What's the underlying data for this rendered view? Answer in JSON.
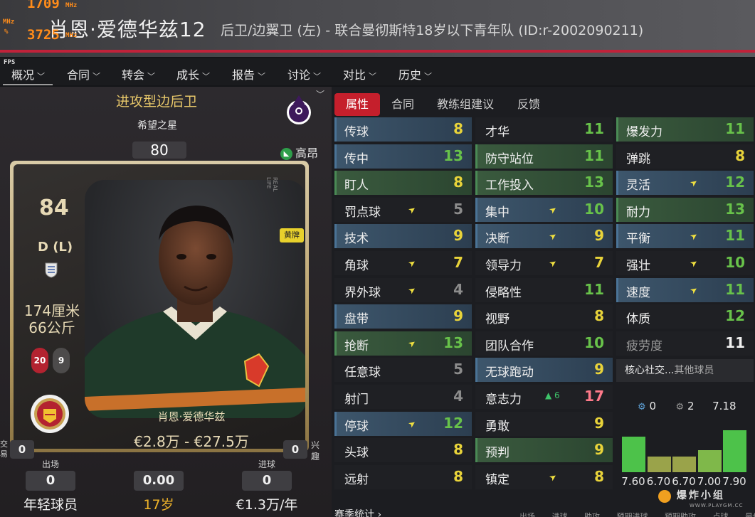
{
  "overlay": {
    "line1": "1709",
    "line2": "3725",
    "unit": "MHz",
    "fps": "FPS"
  },
  "header": {
    "title": "肖恩·爱德华兹12",
    "info": "后卫/边翼卫 (左) - 联合曼彻斯特18岁以下青年队 (ID:r-2002090211)"
  },
  "nav": [
    {
      "label": "概况"
    },
    {
      "label": "合同"
    },
    {
      "label": "转会"
    },
    {
      "label": "成长"
    },
    {
      "label": "报告"
    },
    {
      "label": "讨论"
    },
    {
      "label": "对比"
    },
    {
      "label": "历史"
    }
  ],
  "profile": {
    "role": "进攻型边后卫",
    "subtitle": "希望之星",
    "ovr": "80",
    "stars": {
      "full": 1,
      "half": 1,
      "empty": 3
    },
    "height_tag": "高昂",
    "card": {
      "rating": "84",
      "position": "D (L)",
      "height": "174厘米",
      "weight": "66公斤",
      "pill_red": "20",
      "pill_grey": "9",
      "real_life": "REAL LIFE",
      "yellow_tag": "黄牌",
      "name": "肖恩·爱德华兹",
      "value": "€2.8万 - €27.5万"
    },
    "left_side_label": "交易",
    "left_side_value": "0",
    "right_side_label": "兴趣",
    "right_side_value": "0",
    "stats": [
      {
        "label": "出场",
        "value": "0",
        "text": "年轻球员",
        "gold": false
      },
      {
        "label": "",
        "value": "0.00",
        "text": "17岁",
        "gold": true
      },
      {
        "label": "进球",
        "value": "0",
        "text": "€1.3万/年",
        "gold": false
      }
    ]
  },
  "tabs": [
    {
      "label": "属性",
      "active": true
    },
    {
      "label": "合同",
      "active": false
    },
    {
      "label": "教练组建议",
      "active": false
    },
    {
      "label": "反馈",
      "active": false
    }
  ],
  "attributes": {
    "col1": [
      {
        "name": "传球",
        "value": "8",
        "bg": "blue",
        "color": "yellow",
        "arrow": false
      },
      {
        "name": "传中",
        "value": "13",
        "bg": "blue",
        "color": "green",
        "arrow": false
      },
      {
        "name": "盯人",
        "value": "8",
        "bg": "green",
        "color": "yellow",
        "arrow": false
      },
      {
        "name": "罚点球",
        "value": "5",
        "bg": "none",
        "color": "grey",
        "arrow": true
      },
      {
        "name": "技术",
        "value": "9",
        "bg": "blue",
        "color": "yellow",
        "arrow": false
      },
      {
        "name": "角球",
        "value": "7",
        "bg": "none",
        "color": "yellow",
        "arrow": true
      },
      {
        "name": "界外球",
        "value": "4",
        "bg": "none",
        "color": "grey",
        "arrow": true
      },
      {
        "name": "盘带",
        "value": "9",
        "bg": "blue",
        "color": "yellow",
        "arrow": false
      },
      {
        "name": "抢断",
        "value": "13",
        "bg": "green",
        "color": "green",
        "arrow": true
      },
      {
        "name": "任意球",
        "value": "5",
        "bg": "none",
        "color": "grey",
        "arrow": false
      },
      {
        "name": "射门",
        "value": "4",
        "bg": "none",
        "color": "grey",
        "arrow": false
      },
      {
        "name": "停球",
        "value": "12",
        "bg": "blue",
        "color": "green",
        "arrow": true
      },
      {
        "name": "头球",
        "value": "8",
        "bg": "none",
        "color": "yellow",
        "arrow": false
      },
      {
        "name": "远射",
        "value": "8",
        "bg": "none",
        "color": "yellow",
        "arrow": false
      }
    ],
    "col2": [
      {
        "name": "才华",
        "value": "11",
        "bg": "none",
        "color": "green",
        "arrow": false
      },
      {
        "name": "防守站位",
        "value": "11",
        "bg": "green",
        "color": "green",
        "arrow": false
      },
      {
        "name": "工作投入",
        "value": "13",
        "bg": "green",
        "color": "green",
        "arrow": false
      },
      {
        "name": "集中",
        "value": "10",
        "bg": "blue",
        "color": "green",
        "arrow": true
      },
      {
        "name": "决断",
        "value": "9",
        "bg": "blue",
        "color": "yellow",
        "arrow": true
      },
      {
        "name": "领导力",
        "value": "7",
        "bg": "none",
        "color": "yellow",
        "arrow": true
      },
      {
        "name": "侵略性",
        "value": "11",
        "bg": "none",
        "color": "green",
        "arrow": false
      },
      {
        "name": "视野",
        "value": "8",
        "bg": "none",
        "color": "yellow",
        "arrow": false
      },
      {
        "name": "团队合作",
        "value": "10",
        "bg": "none",
        "color": "green",
        "arrow": false
      },
      {
        "name": "无球跑动",
        "value": "9",
        "bg": "blue",
        "color": "yellow",
        "arrow": false
      },
      {
        "name": "意志力",
        "value": "17",
        "bg": "none",
        "color": "pink",
        "arrow": false,
        "delta": "▲ 6"
      },
      {
        "name": "勇敢",
        "value": "9",
        "bg": "none",
        "color": "yellow",
        "arrow": false
      },
      {
        "name": "预判",
        "value": "9",
        "bg": "green",
        "color": "yellow",
        "arrow": false
      },
      {
        "name": "镇定",
        "value": "8",
        "bg": "none",
        "color": "yellow",
        "arrow": true
      }
    ],
    "col3": [
      {
        "name": "爆发力",
        "value": "11",
        "bg": "green",
        "color": "green",
        "arrow": false
      },
      {
        "name": "弹跳",
        "value": "8",
        "bg": "none",
        "color": "yellow",
        "arrow": false
      },
      {
        "name": "灵活",
        "value": "12",
        "bg": "blue",
        "color": "green",
        "arrow": true
      },
      {
        "name": "耐力",
        "value": "13",
        "bg": "green",
        "color": "green",
        "arrow": false
      },
      {
        "name": "平衡",
        "value": "11",
        "bg": "blue",
        "color": "green",
        "arrow": true
      },
      {
        "name": "强壮",
        "value": "10",
        "bg": "none",
        "color": "green",
        "arrow": true
      },
      {
        "name": "速度",
        "value": "11",
        "bg": "blue",
        "color": "green",
        "arrow": true
      },
      {
        "name": "体质",
        "value": "12",
        "bg": "none",
        "color": "green",
        "arrow": false
      },
      {
        "name": "疲劳度",
        "value": "11",
        "bg": "none",
        "color": "white",
        "arrow": false,
        "muted": true
      }
    ]
  },
  "social": {
    "core": "核心社交...",
    "other": "其他球员"
  },
  "morale": {
    "a": "0",
    "b": "2",
    "avg": "7.18"
  },
  "form_bars": {
    "values": [
      7.6,
      6.7,
      6.7,
      7.0,
      7.9
    ],
    "labels": [
      "7.60",
      "6.70",
      "6.70",
      "7.00",
      "7.90"
    ],
    "colors": [
      "#4dc24a",
      "#9aa34a",
      "#9aa34a",
      "#7fb84a",
      "#4dc24a"
    ]
  },
  "season": {
    "title": "赛季统计 ›",
    "cols": "出场 进球 助攻 预期进球 预期助攻 点球 最佳"
  },
  "watermark": {
    "big": "爆炸小组",
    "sub": "WWW.PLAYGM.CC"
  }
}
